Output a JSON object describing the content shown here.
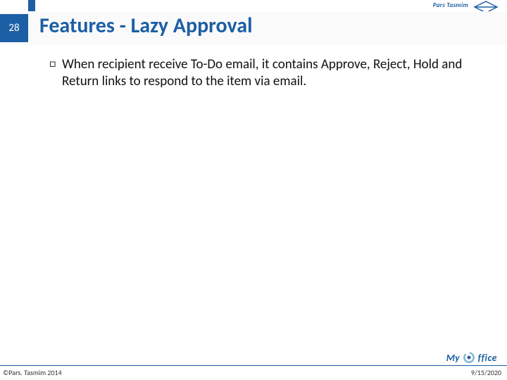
{
  "slide_number": "28",
  "title": "Features - Lazy Approval",
  "bullet_marker": "□",
  "body_text": "When recipient receive To-Do email, it contains Approve, Reject, Hold and Return links to respond to the item via email.",
  "brand": {
    "text": "Pars Tasmim"
  },
  "footer": {
    "copyright": "©Pars. Tasmim 2014",
    "date": "9/15/2020",
    "logo_left": "My",
    "logo_right": "ffice"
  }
}
